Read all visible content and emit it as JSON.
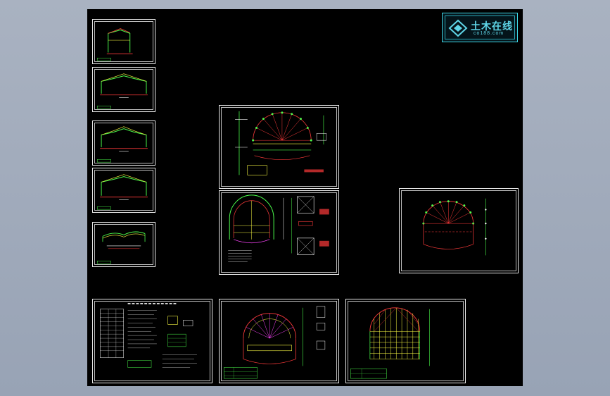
{
  "logo": {
    "main_text": "土木在线",
    "sub_text": "co188.com",
    "icon": "diamond-logo-icon"
  },
  "colors": {
    "desktop": "#a9b2c1",
    "canvas": "#000000",
    "frame": "#e8e8e8",
    "accent_cyan": "#3fd7e6",
    "line_green": "#4cff4c",
    "line_red": "#ff3b3b",
    "line_yellow": "#ffff44",
    "line_magenta": "#ff44ff"
  },
  "sheets": [
    {
      "id": "sheet-1",
      "kind": "portal-frame-elevation"
    },
    {
      "id": "sheet-2",
      "kind": "portal-frame-elevation"
    },
    {
      "id": "sheet-3",
      "kind": "portal-frame-elevation"
    },
    {
      "id": "sheet-4",
      "kind": "portal-frame-elevation"
    },
    {
      "id": "sheet-5",
      "kind": "portal-frame-elevation"
    },
    {
      "id": "sheet-6",
      "kind": "arch-details"
    },
    {
      "id": "sheet-7",
      "kind": "arch-plan"
    },
    {
      "id": "sheet-8",
      "kind": "arch-elevation"
    },
    {
      "id": "sheet-9",
      "kind": "design-notes"
    },
    {
      "id": "sheet-10",
      "kind": "arch-section"
    },
    {
      "id": "sheet-11",
      "kind": "dome-grid"
    }
  ]
}
